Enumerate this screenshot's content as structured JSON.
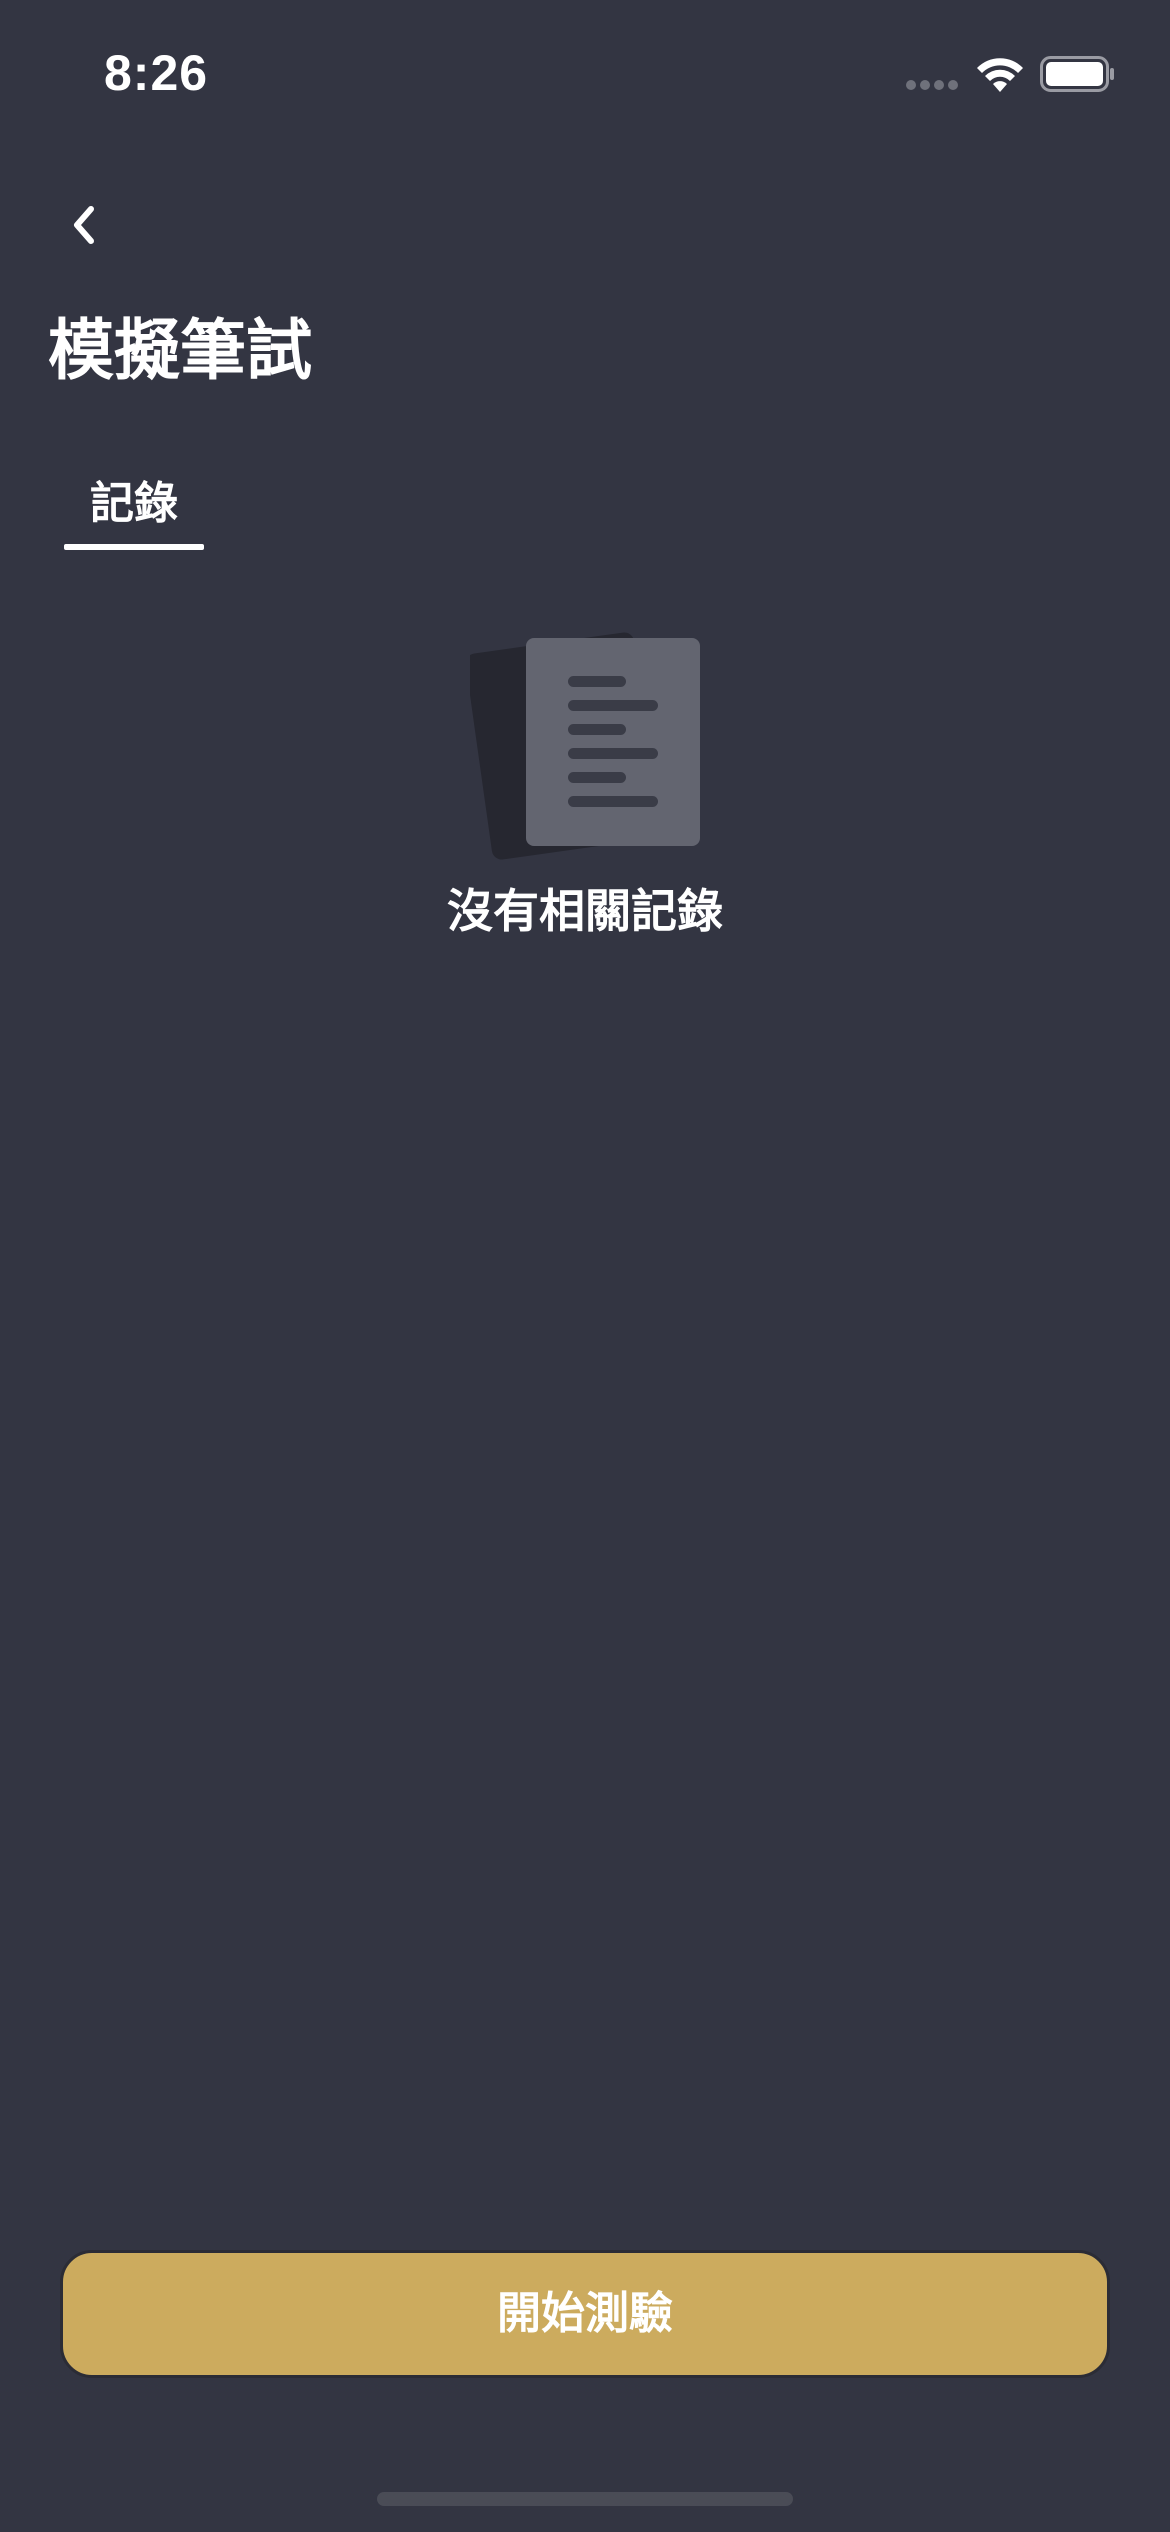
{
  "status_bar": {
    "time": "8:26",
    "icons": [
      "signal-dots-icon",
      "wifi-icon",
      "battery-icon"
    ]
  },
  "nav": {
    "back_icon": "chevron-left-icon",
    "title": "模擬筆試"
  },
  "tabs": [
    {
      "label": "記錄",
      "selected": true
    }
  ],
  "empty_state": {
    "icon": "document-stack-icon",
    "message": "沒有相關記錄"
  },
  "actions": {
    "start_label": "開始測驗"
  },
  "colors": {
    "background": "#333542",
    "accent": "#ccab5e",
    "text": "#ffffff",
    "icon_muted": "#636570",
    "icon_dark": "#262730"
  }
}
